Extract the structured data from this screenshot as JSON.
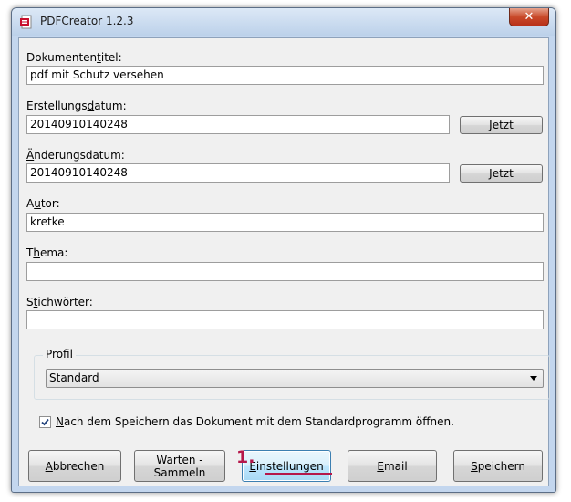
{
  "window": {
    "title": "PDFCreator 1.2.3",
    "close_label": "✕"
  },
  "fields": {
    "dokumententitel": {
      "label_before": "Dokumenten",
      "label_u": "t",
      "label_after": "itel:",
      "value": "pdf mit Schutz versehen"
    },
    "erstellungsdatum": {
      "label_before": "Erstellungs",
      "label_u": "d",
      "label_after": "atum:",
      "value": "20140910140248",
      "button": "Jetzt"
    },
    "aenderungsdatum": {
      "label_before": "",
      "label_u": "Ä",
      "label_after": "nderungsdatum:",
      "value": "20140910140248",
      "button": "Jetzt"
    },
    "autor": {
      "label_before": "A",
      "label_u": "u",
      "label_after": "tor:",
      "value": "kretke"
    },
    "thema": {
      "label_before": "T",
      "label_u": "h",
      "label_after": "ema:",
      "value": ""
    },
    "stichwoerter": {
      "label_before": "S",
      "label_u": "t",
      "label_after": "ichwörter:",
      "value": ""
    }
  },
  "profil": {
    "legend": "Profil",
    "selected": "Standard"
  },
  "open_after_save": {
    "checked": true,
    "label_u": "N",
    "label_after": "ach dem Speichern das Dokument mit dem Standardprogramm öffnen."
  },
  "buttons": {
    "abbrechen": {
      "label_u": "A",
      "label_after": "bbrechen"
    },
    "warten": {
      "line1": "Warten -",
      "line2": "Sammeln"
    },
    "einstellungen": {
      "label_u": "E",
      "label_after": "instellungen"
    },
    "email": {
      "label_u": "E",
      "label_after": "mail"
    },
    "speichern": {
      "label_u": "S",
      "label_after": "peichern"
    }
  },
  "annotation": {
    "step_number": "1.",
    "color": "#b5174a"
  },
  "colors": {
    "title_bar": "#c3d6ee",
    "close_button": "#c94a2a",
    "dialog_background": "#f0f0f0"
  }
}
